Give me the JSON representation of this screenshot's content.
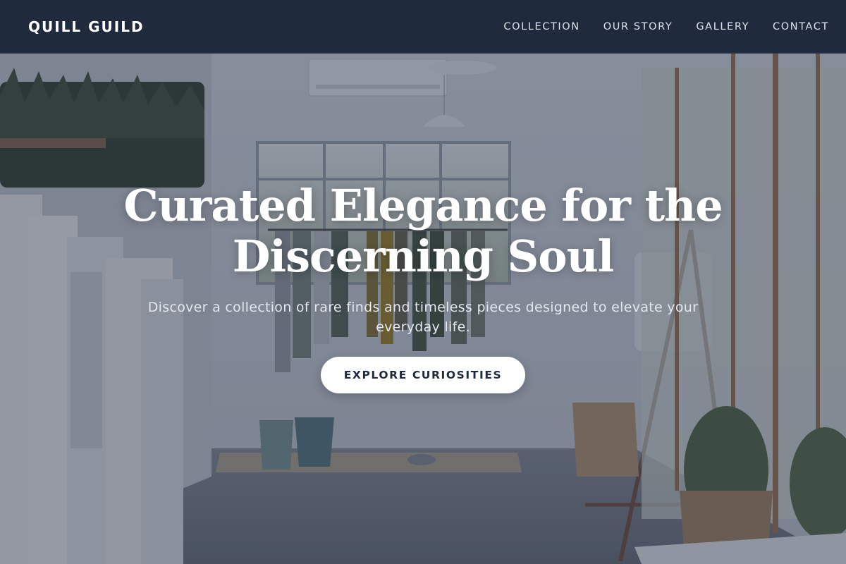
{
  "nav": {
    "brand": "QUILL GUILD",
    "links": [
      {
        "label": "COLLECTION"
      },
      {
        "label": "OUR STORY"
      },
      {
        "label": "GALLERY"
      },
      {
        "label": "CONTACT"
      }
    ]
  },
  "hero": {
    "headline_line1": "Curated Elegance for the",
    "headline_line2": "Discerning Soul",
    "subtext": "Discover a collection of rare finds and timeless pieces designed to elevate your everyday life.",
    "cta_label": "EXPLORE CURIOSITIES",
    "background": "boutique-interior-photo"
  },
  "colors": {
    "navbar": "#1f2a3d",
    "cta_bg": "#ffffff",
    "cta_text": "#1f2a3d",
    "headline": "#ffffff"
  }
}
